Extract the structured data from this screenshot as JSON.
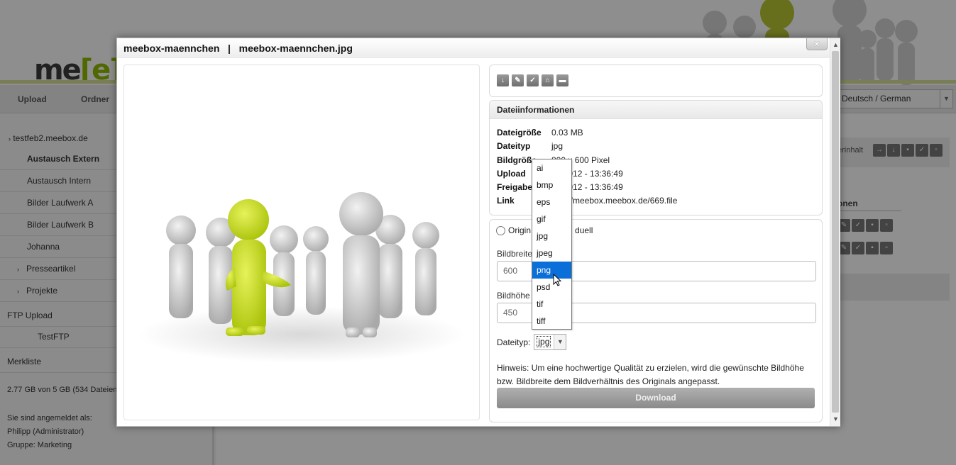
{
  "background": {
    "logo": {
      "text": "me",
      "accent": "[e]"
    },
    "nav": [
      "Upload",
      "Ordner"
    ],
    "language": "Deutsch / German",
    "sidebar": {
      "root": "testfeb2.meebox.de",
      "folders": [
        "Austausch Extern",
        "Austausch Intern",
        "Bilder Laufwerk A",
        "Bilder Laufwerk B",
        "Johanna",
        "Presseartikel",
        "Projekte"
      ],
      "ftp_upload": "FTP Upload",
      "ftp_item": "TestFTP",
      "merkliste": "Merkliste",
      "storage": "2.77 GB von 5 GB (534 Dateien",
      "logged_in_label": "Sie sind angemeldet als:",
      "user": "Philipp (Administrator)",
      "group": "Gruppe: Marketing"
    },
    "right_panel_label": "erinhalt",
    "right_column_label": "onen"
  },
  "modal": {
    "title_left": "meebox-maennchen",
    "title_sep": "|",
    "title_right": "meebox-maennchen.jpg",
    "close_label": "×",
    "toolbar_icons": [
      "download-icon",
      "edit-icon",
      "check-icon",
      "unlock-icon",
      "trash-icon"
    ],
    "info": {
      "heading": "Dateiinformationen",
      "rows": [
        {
          "label": "Dateigröße",
          "value": "0.03 MB"
        },
        {
          "label": "Dateityp",
          "value": "jpg"
        },
        {
          "label": "Bildgröße",
          "value": "800 x 600 Pixel"
        },
        {
          "label": "Upload",
          "value": "02.2012 - 13:36:49"
        },
        {
          "label": "Freigabe",
          "value": "02.2012 - 13:36:49"
        },
        {
          "label": "Link",
          "value": "http://meebox.meebox.de/669.file"
        }
      ]
    },
    "download": {
      "radio_original": "Origin",
      "radio_custom": "duell",
      "width_label": "Bildbreite",
      "width_value": "600",
      "height_label": "Bildhöhe",
      "height_value": "450",
      "type_label": "Dateityp:",
      "type_value": "jpg",
      "hint": "Hinweis: Um eine hochwertige Qualität zu erzielen, wird die gewünschte Bildhöhe bzw. Bildbreite dem Bildverhältnis des Originals angepasst.",
      "button": "Download"
    },
    "dropdown": {
      "options": [
        "ai",
        "bmp",
        "eps",
        "gif",
        "jpg",
        "jpeg",
        "png",
        "psd",
        "tif",
        "tiff"
      ],
      "highlighted": "png"
    }
  },
  "colors": {
    "accent": "#b5cc18",
    "highlight": "#0a6fd8"
  }
}
